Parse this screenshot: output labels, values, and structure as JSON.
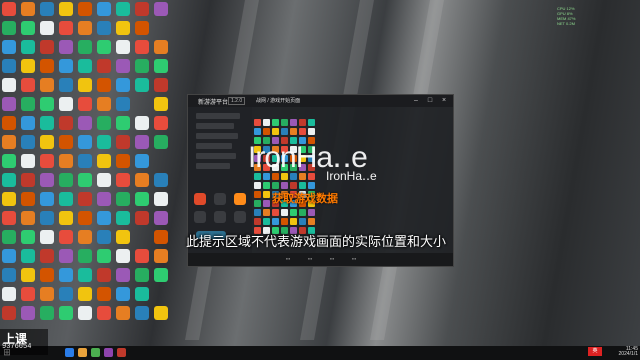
{
  "app": {
    "name": "新游游平台",
    "version": "1.2.0",
    "window_title": "IronHa.e",
    "tab_title": "战网 / 游戏开始页面"
  },
  "overlay": {
    "watermark_main": "IronHa‥e",
    "watermark_small": "IronHa‥e",
    "promo_text": "获取游戏数据",
    "subtitle": "此提示区域不代表游戏画面的实际位置和大小"
  },
  "taskbar": {
    "counter": "9376654",
    "logo": "上课",
    "badge": "英",
    "clock_line1": "11:45",
    "clock_line2": "2024/1/1"
  },
  "colors": {
    "accent": "#ff7a00",
    "badge": "#dd2222"
  },
  "stats": {
    "lines": [
      "CPU 12%",
      "GPU 8%",
      "MEM 47%",
      "NET 0.2M"
    ]
  },
  "icons": {
    "window_controls": [
      "minimize-icon",
      "maximize-icon",
      "close-icon"
    ],
    "start": "windows-start-icon"
  }
}
